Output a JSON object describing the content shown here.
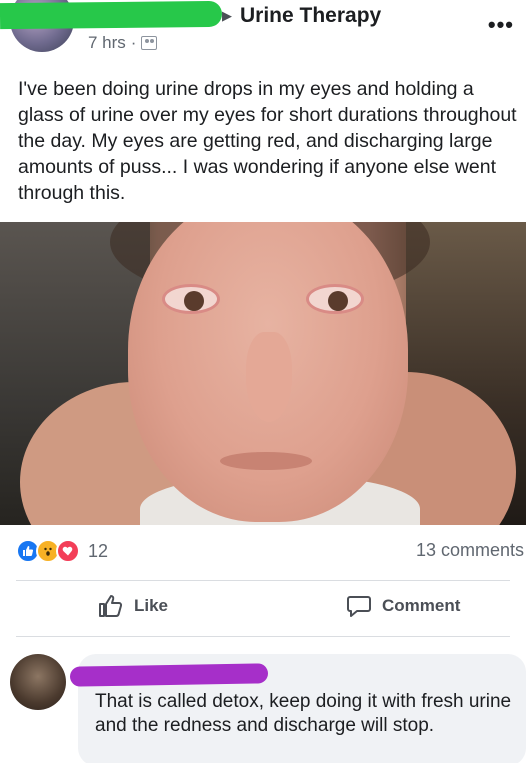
{
  "post": {
    "group_name": "Urine Therapy",
    "time": "7 hrs",
    "separator": "·",
    "audience_icon": "group-icon",
    "more_icon": "more-options-icon",
    "text": "I've been doing urine drops in my eyes and holding a glass of urine over my eyes for short durations throughout the day. My eyes are getting red, and discharging large amounts of puss... I was wondering if anyone else went through this."
  },
  "stats": {
    "reaction_icons": [
      "like-icon",
      "wow-icon",
      "love-icon"
    ],
    "reaction_count": "12",
    "comments_count": "13 comments"
  },
  "actions": {
    "like_label": "Like",
    "comment_label": "Comment"
  },
  "comment": {
    "text": "That is called detox, keep doing it with fresh urine and the redness and discharge will stop."
  },
  "colors": {
    "redaction_green": "#27c84a",
    "redaction_purple": "#a62fc9",
    "like_blue": "#1877f2",
    "wow_yellow": "#f7b125",
    "love_red": "#f33e58",
    "comment_bubble": "#f0f2f5"
  }
}
